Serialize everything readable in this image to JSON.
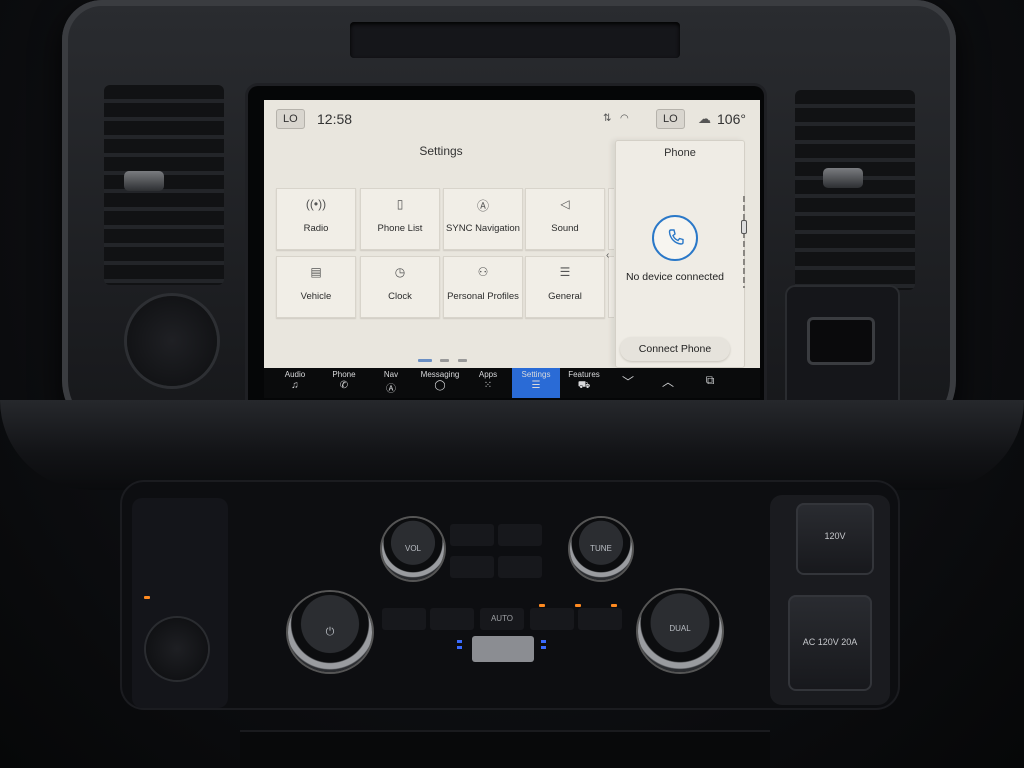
{
  "status_bar": {
    "left_climate": "LO",
    "time": "12:58",
    "right_climate": "LO",
    "outside_temp": "106°"
  },
  "settings": {
    "title": "Settings",
    "tiles": [
      {
        "label": "Radio",
        "icon": "radio-signal-icon",
        "glyph": "((•))"
      },
      {
        "label": "Phone List",
        "icon": "phone-list-icon",
        "glyph": "▯"
      },
      {
        "label": "SYNC Navigation",
        "icon": "navigation-icon",
        "glyph": "Ⓐ"
      },
      {
        "label": "Sound",
        "icon": "speaker-icon",
        "glyph": "◁"
      },
      {
        "label": "Vehicle",
        "icon": "vehicle-icon",
        "glyph": "▤"
      },
      {
        "label": "Clock",
        "icon": "clock-icon",
        "glyph": "◷"
      },
      {
        "label": "Personal Profiles",
        "icon": "profiles-icon",
        "glyph": "⚇"
      },
      {
        "label": "General",
        "icon": "sliders-icon",
        "glyph": "☰"
      }
    ]
  },
  "phone_panel": {
    "title": "Phone",
    "message": "No device connected",
    "connect_label": "Connect Phone"
  },
  "dock": {
    "items": [
      {
        "label": "Audio",
        "icon": "music-note-icon",
        "glyph": "♫",
        "active": false
      },
      {
        "label": "Phone",
        "icon": "phone-icon",
        "glyph": "✆",
        "active": false
      },
      {
        "label": "Nav",
        "icon": "navigation-icon",
        "glyph": "Ⓐ",
        "active": false
      },
      {
        "label": "Messaging",
        "icon": "messaging-icon",
        "glyph": "◯",
        "active": false
      },
      {
        "label": "Apps",
        "icon": "apps-grid-icon",
        "glyph": "⁙",
        "active": false
      },
      {
        "label": "Settings",
        "icon": "settings-sliders-icon",
        "glyph": "☰",
        "active": true
      },
      {
        "label": "Features",
        "icon": "vehicle-features-icon",
        "glyph": "⛟",
        "active": false
      }
    ],
    "accent_color": "#2a6bd6"
  },
  "console": {
    "vol_label": "VOL",
    "tune_label": "TUNE",
    "dual_label": "DUAL",
    "auto_label": "AUTO",
    "outlet_label": "120V",
    "outlet_rating": "AC 120V 20A"
  }
}
